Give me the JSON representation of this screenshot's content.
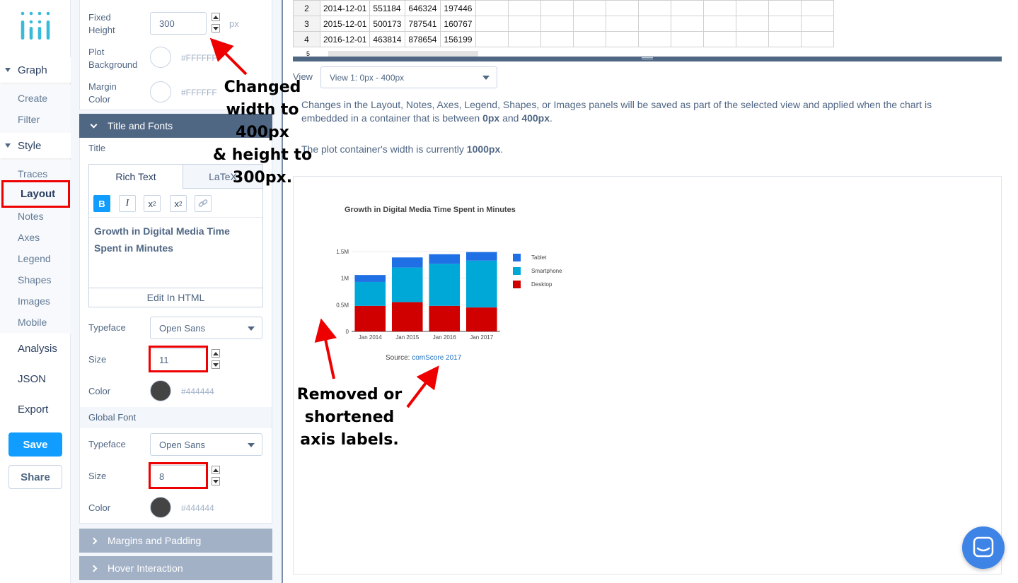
{
  "nav": {
    "graph": "Graph",
    "create": "Create",
    "filter": "Filter",
    "style": "Style",
    "traces": "Traces",
    "layout": "Layout",
    "notes": "Notes",
    "axes": "Axes",
    "legend": "Legend",
    "shapes": "Shapes",
    "images": "Images",
    "mobile": "Mobile",
    "analysis": "Analysis",
    "json": "JSON",
    "export": "Export",
    "save": "Save",
    "share": "Share"
  },
  "panel": {
    "fixed_height_label_1": "Fixed",
    "fixed_height_label_2": "Height",
    "fixed_height_value": "300",
    "px_unit": "px",
    "plot_bg_label_1": "Plot",
    "plot_bg_label_2": "Background",
    "plot_bg_hex": "#FFFFFF",
    "margin_color_label_1": "Margin",
    "margin_color_label_2": "Color",
    "margin_color_hex": "#FFFFFF",
    "title_fonts_header": "Title and Fonts",
    "title_label": "Title",
    "tab_rich": "Rich Text",
    "tab_latex": "LaTeX",
    "bold": "B",
    "italic": "I",
    "subscript": "x",
    "sub_mark": "2",
    "superscript": "x",
    "sup_mark": "2",
    "title_text": "Growth in Digital Media Time Spent in Minutes",
    "edit_html": "Edit In HTML",
    "typeface_label": "Typeface",
    "typeface_value": "Open Sans",
    "size_label": "Size",
    "title_size_value": "11",
    "color_label": "Color",
    "title_color_hex": "#444444",
    "global_font_label": "Global Font",
    "global_typeface_value": "Open Sans",
    "global_size_value": "8",
    "global_color_hex": "#444444",
    "margins_header": "Margins and Padding",
    "hover_header": "Hover Interaction"
  },
  "table": {
    "rows": [
      [
        "2",
        "2014-12-01",
        "551184",
        "646324",
        "197446"
      ],
      [
        "3",
        "2015-12-01",
        "500173",
        "787541",
        "160767"
      ],
      [
        "4",
        "2016-12-01",
        "463814",
        "878654",
        "156199"
      ]
    ],
    "partial_row_index": "5"
  },
  "main": {
    "view_label": "View",
    "view_value": "View 1: 0px - 400px",
    "changes_text_1": "Changes in the Layout, Notes, Axes, Legend, Shapes, or Images panels will be saved as part of the selected view and applied when the chart is",
    "changes_text_2a": "embedded in a container that is between ",
    "changes_bold_1": "0px",
    "changes_text_2b": " and ",
    "changes_bold_2": "400px",
    "changes_text_2c": ".",
    "width_text": "The plot container's width is currently ",
    "width_bold": "1000px",
    "width_end": "."
  },
  "chart_data": {
    "type": "bar",
    "title": "Growth in Digital Media Time Spent in Minutes",
    "categories": [
      "Jan 2014",
      "Jan 2015",
      "Jan 2016",
      "Jan 2017"
    ],
    "series": [
      {
        "name": "Desktop",
        "color": "#d00000",
        "values": [
          480000,
          550000,
          480000,
          450000
        ]
      },
      {
        "name": "Smartphone",
        "color": "#00a8d8",
        "values": [
          450000,
          650000,
          790000,
          880000
        ]
      },
      {
        "name": "Tablet",
        "color": "#1f6fe5",
        "values": [
          130000,
          190000,
          180000,
          160000
        ]
      }
    ],
    "legend_order": [
      "Tablet",
      "Smartphone",
      "Desktop"
    ],
    "yticks": [
      "0",
      "0.5M",
      "1M",
      "1.5M"
    ],
    "ylim": [
      0,
      1500000
    ],
    "source_prefix": "Source: ",
    "source_link": "comScore 2017",
    "link_color": "#1f6fbf"
  },
  "annotations": {
    "size_note_lines": [
      "Changed",
      "width to",
      "400px",
      "& height to",
      "300px."
    ],
    "axis_note_lines": [
      "Removed or",
      "shortened",
      "axis labels."
    ]
  },
  "colors": {
    "accent": "#119dff",
    "section_header": "#506784",
    "collapsed_header": "#a2b1c6",
    "highlight": "#ee0000"
  }
}
